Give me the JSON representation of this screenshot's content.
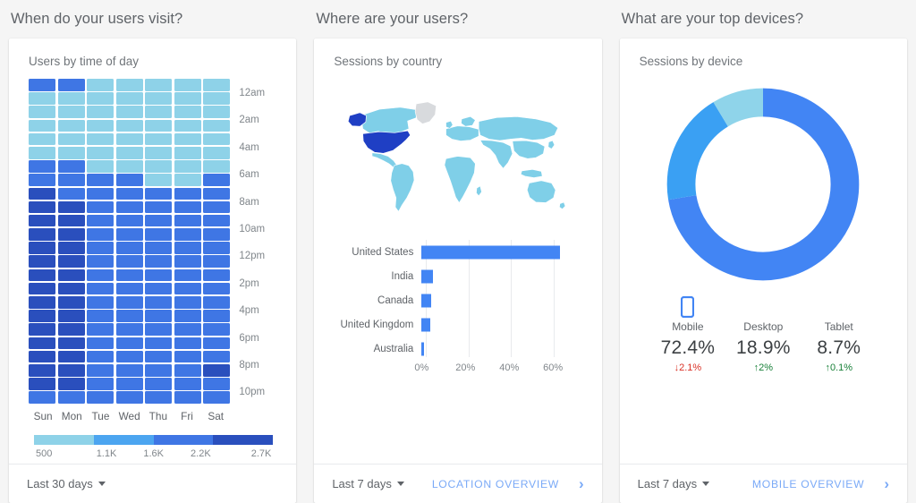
{
  "columns": [
    {
      "section_title": "When do your users visit?",
      "card_title": "Users by time of day",
      "footer": {
        "date_range": "Last 30 days",
        "link": null
      }
    },
    {
      "section_title": "Where are your users?",
      "card_title": "Sessions by country",
      "footer": {
        "date_range": "Last 7 days",
        "link": "LOCATION OVERVIEW"
      }
    },
    {
      "section_title": "What are your top devices?",
      "card_title": "Sessions by device",
      "footer": {
        "date_range": "Last 7 days",
        "link": "MOBILE OVERVIEW"
      }
    }
  ],
  "colors": {
    "accent": "#4285f4",
    "link": "#7baaf7",
    "heat_1": "#8ed2e8",
    "heat_2": "#4ca5f0",
    "heat_3": "#3f76e4",
    "heat_4": "#2a4fbd",
    "donut_mobile": "#4285f4",
    "donut_desktop": "#3aa0f3",
    "donut_tablet": "#8fd4ea",
    "map_base": "#7fcfe8",
    "map_max": "#1f3fc4",
    "map_none": "#d8dadd",
    "delta_down": "#d93025",
    "delta_up": "#188038"
  },
  "chart_data": [
    {
      "type": "heatmap",
      "title": "Users by time of day",
      "xlabel": "",
      "ylabel": "",
      "categories": [
        "Sun",
        "Mon",
        "Tue",
        "Wed",
        "Thu",
        "Fri",
        "Sat"
      ],
      "row_labels": [
        "12am",
        "",
        "2am",
        "",
        "4am",
        "",
        "6am",
        "",
        "8am",
        "",
        "10am",
        "",
        "12pm",
        "",
        "2pm",
        "",
        "4pm",
        "",
        "6pm",
        "",
        "8pm",
        "",
        "10pm",
        ""
      ],
      "legend": {
        "ticks": [
          "500",
          "1.1K",
          "1.6K",
          "2.2K",
          "2.7K"
        ],
        "bands": [
          "#8ed2e8",
          "#4ca5f0",
          "#3f76e4",
          "#2a4fbd"
        ]
      },
      "scale_min": 500,
      "scale_max": 2700,
      "values": [
        [
          1700,
          1700,
          800,
          800,
          800,
          800,
          800
        ],
        [
          800,
          800,
          800,
          800,
          800,
          800,
          800
        ],
        [
          800,
          800,
          800,
          800,
          800,
          800,
          800
        ],
        [
          800,
          800,
          800,
          800,
          800,
          800,
          800
        ],
        [
          800,
          800,
          800,
          800,
          800,
          800,
          800
        ],
        [
          800,
          800,
          800,
          800,
          800,
          800,
          800
        ],
        [
          1700,
          1700,
          800,
          800,
          800,
          800,
          800
        ],
        [
          1700,
          1700,
          1700,
          1700,
          900,
          900,
          1750
        ],
        [
          2150,
          1700,
          1700,
          1700,
          1700,
          1700,
          1700
        ],
        [
          2200,
          2200,
          1700,
          1750,
          1750,
          1750,
          1750
        ],
        [
          2200,
          2200,
          1750,
          1750,
          1750,
          1750,
          1750
        ],
        [
          2250,
          2250,
          1750,
          1750,
          1750,
          1750,
          1750
        ],
        [
          2300,
          2300,
          1750,
          1750,
          1750,
          1750,
          1750
        ],
        [
          2250,
          2250,
          1750,
          1750,
          1750,
          1750,
          1750
        ],
        [
          2250,
          2250,
          1750,
          1750,
          1750,
          1750,
          1750
        ],
        [
          2250,
          2250,
          1750,
          1750,
          1750,
          1750,
          1750
        ],
        [
          2250,
          2200,
          1800,
          1800,
          1800,
          1800,
          1800
        ],
        [
          2250,
          2250,
          1800,
          1800,
          1800,
          1800,
          1800
        ],
        [
          2250,
          2200,
          1800,
          1800,
          1800,
          1800,
          1800
        ],
        [
          2650,
          2200,
          1850,
          1850,
          1800,
          1800,
          1800
        ],
        [
          2700,
          2650,
          1900,
          1900,
          1900,
          1800,
          1800
        ],
        [
          2650,
          2650,
          2100,
          2100,
          2100,
          1800,
          2200
        ],
        [
          2650,
          2150,
          2100,
          2100,
          1800,
          1800,
          1800
        ],
        [
          1800,
          1700,
          1700,
          1700,
          1700,
          1700,
          1700
        ]
      ]
    },
    {
      "type": "bar",
      "title": "Sessions by country",
      "orientation": "horizontal",
      "categories": [
        "United States",
        "India",
        "Canada",
        "United Kingdom",
        "Australia"
      ],
      "values": [
        63,
        5.2,
        4.4,
        3.8,
        1.1
      ],
      "xlabel": "",
      "ylabel": "",
      "xlim": [
        0,
        70
      ],
      "ticks": [
        "0%",
        "20%",
        "40%",
        "60%"
      ],
      "tick_values": [
        0,
        20,
        40,
        60
      ],
      "grid": true,
      "bar_color": "#4285f4"
    },
    {
      "type": "pie",
      "variant": "donut",
      "title": "Sessions by device",
      "labels": [
        "Mobile",
        "Desktop",
        "Tablet"
      ],
      "values": [
        72.4,
        18.9,
        8.7
      ],
      "colors": [
        "#4285f4",
        "#3aa0f3",
        "#8fd4ea"
      ],
      "legend_position": "bottom"
    }
  ],
  "map": {
    "highlight_country": "United States",
    "no_data_country": "Greenland"
  },
  "devices": [
    {
      "icon": "mobile-phone-icon",
      "name": "Mobile",
      "value": "72.4%",
      "delta": "2.1%",
      "delta_dir": "down",
      "delta_arrow": "↓"
    },
    {
      "icon": null,
      "name": "Desktop",
      "value": "18.9%",
      "delta": "2%",
      "delta_dir": "up",
      "delta_arrow": "↑"
    },
    {
      "icon": null,
      "name": "Tablet",
      "value": "8.7%",
      "delta": "0.1%",
      "delta_dir": "up",
      "delta_arrow": "↑"
    }
  ]
}
